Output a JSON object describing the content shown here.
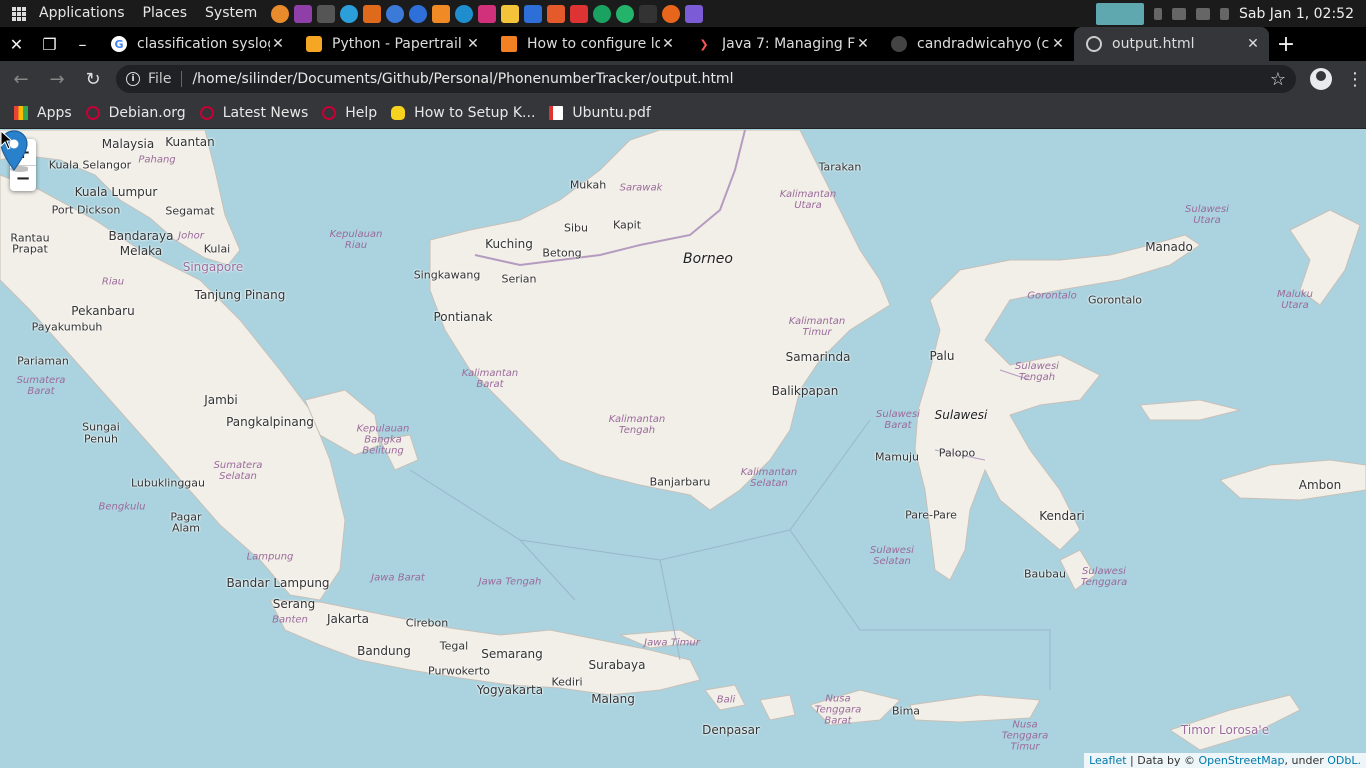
{
  "system_bar": {
    "menus": [
      "Applications",
      "Places",
      "System"
    ],
    "clock": "Sab Jan 1, 02:52"
  },
  "tabs": [
    {
      "title": "classification syslog",
      "icon": "google-icon"
    },
    {
      "title": "Python - Papertrail",
      "icon": "papertrail-icon"
    },
    {
      "title": "How to configure lo",
      "icon": "stackoverflow-icon"
    },
    {
      "title": "Java 7: Managing F",
      "icon": "codecademy-icon"
    },
    {
      "title": "candradwicahyo (ca",
      "icon": "github-icon"
    },
    {
      "title": "output.html",
      "icon": "globe-icon",
      "active": true
    }
  ],
  "toolbar": {
    "file_label": "File",
    "url": "/home/silinder/Documents/Github/Personal/PhonenumberTracker/output.html"
  },
  "bookmarks": [
    "Apps",
    "Debian.org",
    "Latest News",
    "Help",
    "How to Setup K...",
    "Ubuntu.pdf"
  ],
  "map": {
    "zoom_in": "+",
    "zoom_out": "−",
    "attribution": {
      "leaflet": "Leaflet",
      "sep": " | Data by © ",
      "osm": "OpenStreetMap",
      "under": ", under ",
      "odbl": "ODbL."
    },
    "cities": [
      "Malaysia",
      "Kuantan",
      "Kuala Selangor",
      "Pahang",
      "Kuala Lumpur",
      "Segamat",
      "Port Dickson",
      "Bandaraya",
      "Melaka",
      "Johor",
      "Kulai",
      "Singapore",
      "Tanjung Pinang",
      "Rantau",
      "Prapat",
      "Pekanbaru",
      "Riau",
      "Payakumbuh",
      "Pariaman",
      "Jambi",
      "Sungai",
      "Penuh",
      "Pangkalpinang",
      "Lubuklinggau",
      "Bengkulu",
      "Pagar",
      "Alam",
      "Bandar Lampung",
      "Serang",
      "Jakarta",
      "Cirebon",
      "Bandung",
      "Tegal",
      "Semarang",
      "Purwokerto",
      "Yogyakarta",
      "Kediri",
      "Surabaya",
      "Malang",
      "Denpasar",
      "Kuching",
      "Serian",
      "Sibu",
      "Betong",
      "Mukah",
      "Kapit",
      "Singkawang",
      "Pontianak",
      "Banjarbaru",
      "Samarinda",
      "Balikpapan",
      "Tarakan",
      "Palu",
      "Mamuju",
      "Palopo",
      "Pare-Pare",
      "Kendari",
      "Baubau",
      "Manado",
      "Gorontalo",
      "Ambon",
      "Bima"
    ],
    "regions": [
      "Sarawak",
      "Kalimantan Utara",
      "Kalimantan Timur",
      "Kalimantan Barat",
      "Kalimantan Tengah",
      "Kalimantan Selatan",
      "Sulawesi Barat",
      "Sulawesi Tengah",
      "Sulawesi Selatan",
      "Sulawesi Tenggara",
      "Sulawesi Utara",
      "Gorontalo",
      "Maluku Utara",
      "Kepulauan Riau",
      "Kepulauan Bangka Belitung",
      "Sumatera Barat",
      "Sumatera Selatan",
      "Lampung",
      "Banten",
      "Jawa Barat",
      "Jawa Tengah",
      "Jawa Timur",
      "Bali",
      "Nusa Tenggara Barat",
      "Nusa Tenggara Timur",
      "Timor Lorosa'e"
    ],
    "islands": [
      "Borneo",
      "Sulawesi"
    ]
  }
}
